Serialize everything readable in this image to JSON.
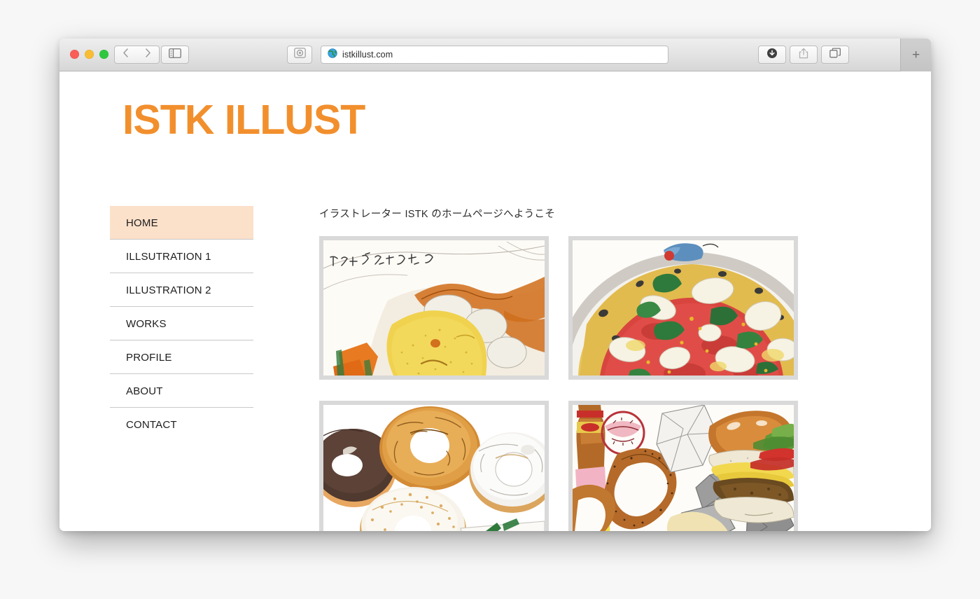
{
  "browser": {
    "url": "istkillust.com",
    "favicon_icon": "globe-icon",
    "traffic_lights": [
      "close-red",
      "minimize-yellow",
      "maximize-green"
    ],
    "back_icon": "chevron-left-icon",
    "forward_icon": "chevron-right-icon",
    "sidebar_icon": "sidebar-panel-icon",
    "reader_icon": "reader-view-icon",
    "download_icon": "download-arrow-icon",
    "share_icon": "share-up-arrow-icon",
    "tabs_icon": "tab-overview-icon",
    "new_tab_label": "+"
  },
  "site": {
    "logo": "ISTK ILLUST",
    "accent_color": "#f28f2d",
    "active_nav_bg": "#fbe0ca",
    "frame_color": "#d9d9d9"
  },
  "nav": {
    "items": [
      {
        "label": "HOME",
        "active": true
      },
      {
        "label": "ILLSUTRATION 1",
        "active": false
      },
      {
        "label": "ILLUSTRATION 2",
        "active": false
      },
      {
        "label": "WORKS",
        "active": false
      },
      {
        "label": "PROFILE",
        "active": false
      },
      {
        "label": "ABOUT",
        "active": false
      },
      {
        "label": "CONTACT",
        "active": false
      }
    ]
  },
  "main": {
    "welcome": "イラストレーター ISTK のホームページへようこそ",
    "gallery": [
      {
        "name": "pumpkin-croquette-illustration",
        "caption_handwritten": "またのぼちゃだ わ。"
      },
      {
        "name": "margherita-pizza-illustration",
        "caption_handwritten": ""
      },
      {
        "name": "donuts-bagels-illustration",
        "caption_handwritten": ""
      },
      {
        "name": "burger-onion-rings-illustration",
        "caption_handwritten": ""
      }
    ]
  }
}
